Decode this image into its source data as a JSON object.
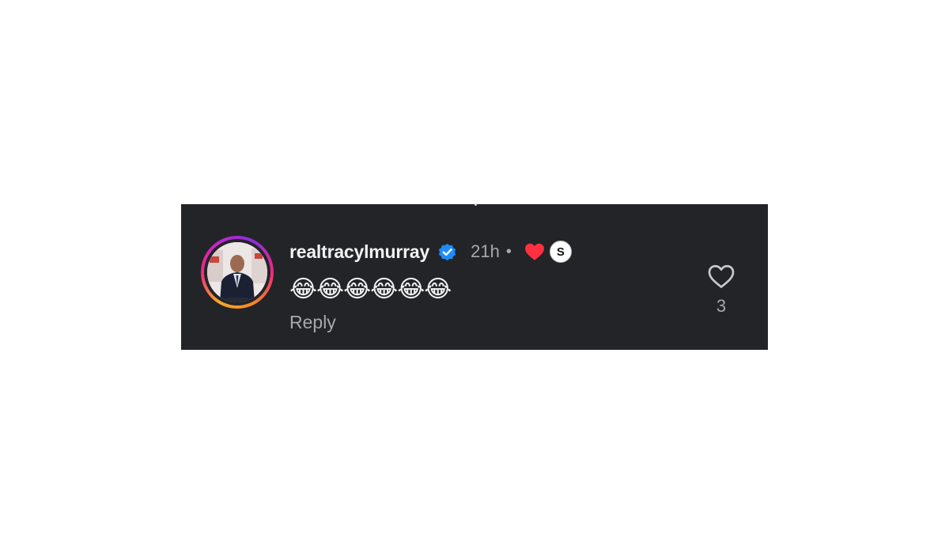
{
  "comment": {
    "username": "realtracylmurray",
    "verified": true,
    "timestamp": "21h",
    "separator": "•",
    "liked_by_creator": true,
    "creator_badge_letter": "S",
    "text": "😂😂😂😂😂😂",
    "reply_label": "Reply",
    "like_count": "3"
  },
  "icons": {
    "verified": "verified-badge-icon",
    "creator_heart": "heart-filled-icon",
    "like": "heart-outline-icon"
  },
  "colors": {
    "background": "#232428",
    "username": "#f2f2f2",
    "secondary_text": "#a8a8a8",
    "verified_blue": "#1d8cf8",
    "creator_heart_red": "#ff3040"
  }
}
